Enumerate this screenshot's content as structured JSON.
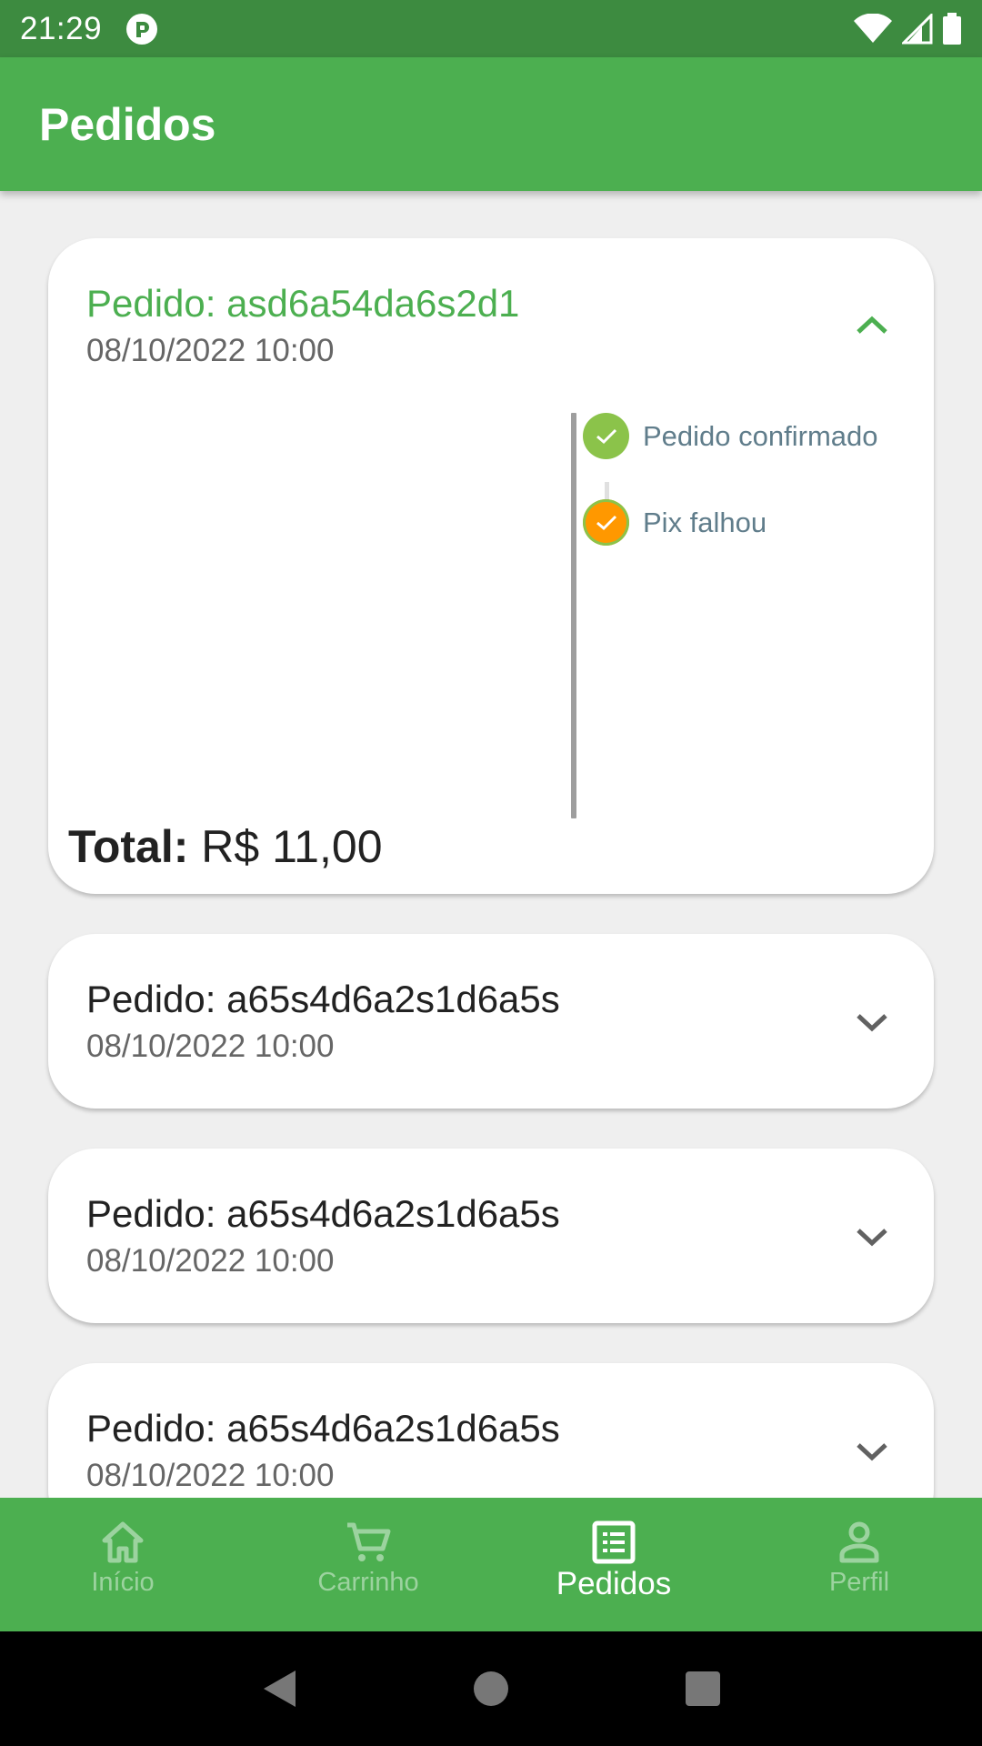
{
  "status_bar": {
    "time": "21:29",
    "icons": [
      "app-notification-icon",
      "wifi-icon",
      "signal-icon",
      "battery-icon"
    ]
  },
  "app_bar": {
    "title": "Pedidos"
  },
  "orders": [
    {
      "title": "Pedido: asd6a54da6s2d1",
      "date": "08/10/2022 10:00",
      "expanded": true,
      "timeline": [
        {
          "label": "Pedido confirmado",
          "color": "#8bc34a"
        },
        {
          "label": "Pix falhou",
          "color": "#ff9800"
        }
      ],
      "total_label": "Total:",
      "total_value": "R$ 11,00"
    },
    {
      "title": "Pedido: a65s4d6a2s1d6a5s",
      "date": "08/10/2022 10:00",
      "expanded": false
    },
    {
      "title": "Pedido: a65s4d6a2s1d6a5s",
      "date": "08/10/2022 10:00",
      "expanded": false
    },
    {
      "title": "Pedido: a65s4d6a2s1d6a5s",
      "date": "08/10/2022 10:00",
      "expanded": false
    }
  ],
  "bottom_nav": {
    "items": [
      {
        "label": "Início",
        "icon": "home-icon",
        "active": false
      },
      {
        "label": "Carrinho",
        "icon": "cart-icon",
        "active": false
      },
      {
        "label": "Pedidos",
        "icon": "list-icon",
        "active": true
      },
      {
        "label": "Perfil",
        "icon": "person-icon",
        "active": false
      }
    ]
  },
  "colors": {
    "primary": "#4caf50",
    "status_bar": "#3d8b40",
    "confirmed": "#8bc34a",
    "failed": "#ff9800"
  }
}
